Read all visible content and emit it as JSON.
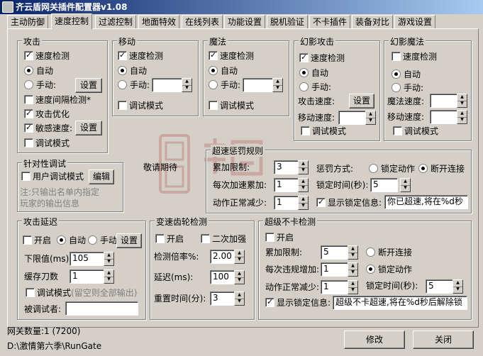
{
  "window": {
    "title": "齐云盾网关插件配置器v1.08"
  },
  "tabs": [
    "主动防御",
    "速度控制",
    "过滤控制",
    "地面特效",
    "在线列表",
    "功能设置",
    "脱机验证",
    "不卡插件",
    "装备对比",
    "游戏设置"
  ],
  "attack": {
    "title": "攻击",
    "speed_check": "速度检测",
    "auto": "自动",
    "manual": "手动:",
    "set": "设置",
    "interval_check": "速度间隔检测*",
    "optimize": "攻击优化",
    "sensitive": "敏感速度:",
    "set2": "设置",
    "debug": "调试模式"
  },
  "move": {
    "title": "移动",
    "speed_check": "速度检测",
    "auto": "自动",
    "manual": "手动:",
    "debug": "调试模式"
  },
  "magic": {
    "title": "魔法",
    "speed_check": "速度检测",
    "auto": "自动",
    "manual": "手动:",
    "debug": "调试模式"
  },
  "phantom_attack": {
    "title": "幻影攻击",
    "speed_check": "速度检测",
    "auto": "自动",
    "manual": "手动:",
    "attack_speed": "攻击速度:",
    "set": "设置",
    "move_speed": "移动速度:",
    "debug": "调试模式"
  },
  "phantom_magic": {
    "title": "幻影魔法",
    "speed_check": "速度检测",
    "auto": "自动",
    "manual": "手动:",
    "magic_speed": "魔法速度:",
    "move_speed": "移动速度:",
    "debug": "调试模式"
  },
  "targeted": {
    "title": "针对性调试",
    "user_debug": "用户调试模式",
    "edit": "编辑",
    "note1": "注:只输出名单内指定",
    "note2": "玩家的输出信息"
  },
  "stay_tuned": "敬请期待",
  "overspeed": {
    "title": "超速惩罚规则",
    "acc_limit": "累加限制:",
    "acc_limit_val": "3",
    "per_acc": "每次加速累加:",
    "per_acc_val": "1",
    "normal_dec": "动作正常减少:",
    "normal_dec_val": "1",
    "punish": "惩罚方式:",
    "lock_action": "锁定动作",
    "disconnect": "断开连接",
    "lock_time": "锁定时间(秒):",
    "lock_time_val": "5",
    "show_lock": "显示锁定信息:",
    "lock_msg": "你已超速,将在%d秒"
  },
  "attack_delay": {
    "title": "攻击延迟",
    "enable": "开启",
    "auto": "自动",
    "manual": "手动",
    "set": "设置",
    "lower": "下限值(ms)",
    "lower_val": "105",
    "cache": "缓存刀数",
    "cache_val": "1",
    "debug": "调试模式",
    "debug_note": "(留空则全部输出)",
    "debugee": "被调试者:"
  },
  "gear": {
    "title": "变速齿轮检测",
    "enable": "开启",
    "double": "二次加强",
    "rate": "检测倍率%:",
    "rate_val": "2.00",
    "delay": "延迟(ms):",
    "delay_val": "100",
    "reset": "重置时间(分):",
    "reset_val": "3"
  },
  "nolag": {
    "title": "超级不卡检测",
    "enable": "开启",
    "acc_limit": "累加限制:",
    "acc_limit_val": "5",
    "disconnect": "断开连接",
    "per_violation": "每次违规增加:",
    "per_violation_val": "1",
    "lock_action": "锁定动作",
    "normal_dec": "动作正常减少:",
    "normal_dec_val": "1",
    "lock_time": "锁定时间(秒):",
    "lock_time_val": "5",
    "show_lock": "显示锁定信息:",
    "lock_msg": "超级不卡超速,将在%d秒后解除锁"
  },
  "status": {
    "gateway_count": "网关数量:1 (7200)",
    "path": "D:\\激情第六季\\RunGate"
  },
  "buttons": {
    "modify": "修改",
    "close": "关闭"
  }
}
